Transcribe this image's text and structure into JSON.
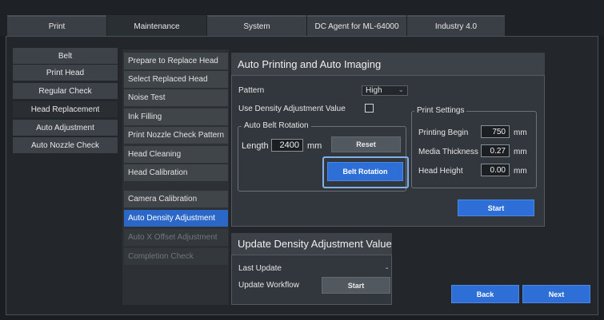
{
  "tabs": [
    "Print",
    "Maintenance",
    "System",
    "DC Agent for ML-64000",
    "Industry 4.0"
  ],
  "sidebar": [
    "Belt",
    "Print Head",
    "Regular Check",
    "Head Replacement",
    "Auto Adjustment",
    "Auto Nozzle Check"
  ],
  "menu": [
    "Prepare to Replace Head",
    "Select Replaced Head",
    "Noise Test",
    "Ink Filling",
    "Print Nozzle Check Pattern",
    "Head Cleaning",
    "Head Calibration",
    "Camera Calibration",
    "Auto Density Adjustment",
    "Auto X Offset Adjustment",
    "Completion Check"
  ],
  "auto": {
    "title": "Auto Printing and Auto Imaging",
    "pattern_label": "Pattern",
    "pattern_value": "High",
    "use_density_label": "Use Density Adjustment Value",
    "belt_group_title": "Auto Belt Rotation",
    "length_label": "Length",
    "length_value": "2400",
    "length_unit": "mm",
    "reset_label": "Reset",
    "belt_rotation_label": "Belt Rotation",
    "print_settings_title": "Print Settings",
    "printing_begin_label": "Printing Begin",
    "printing_begin_value": "750",
    "media_thickness_label": "Media Thickness",
    "media_thickness_value": "0.27",
    "head_height_label": "Head Height",
    "head_height_value": "0.00",
    "unit": "mm",
    "start_label": "Start"
  },
  "update": {
    "title": "Update Density Adjustment Value",
    "last_update_label": "Last Update",
    "last_update_value": "-",
    "workflow_label": "Update Workflow",
    "start_label": "Start"
  },
  "footer": {
    "back_label": "Back",
    "next_label": "Next"
  },
  "colors": {
    "accent": "#2d6fd6",
    "highlight": "#7fb0e8",
    "panel": "#32373d"
  }
}
